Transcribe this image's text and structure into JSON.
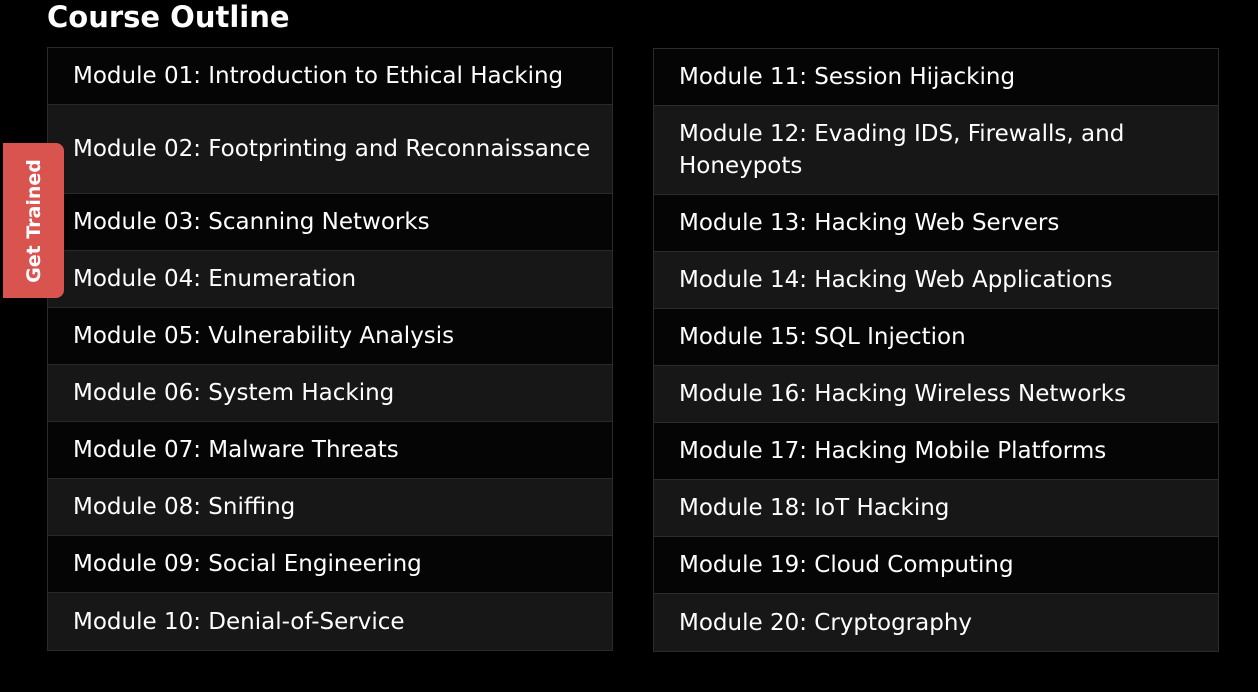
{
  "title": "Course Outline",
  "side_tab": {
    "label": "Get Trained",
    "color": "#d9534f"
  },
  "left_modules": [
    "Module 01: Introduction to Ethical Hacking",
    "Module 02: Footprinting and Reconnaissance",
    "Module 03: Scanning Networks",
    "Module 04: Enumeration",
    "Module 05: Vulnerability Analysis",
    "Module 06: System Hacking",
    "Module 07: Malware Threats",
    "Module 08: Sniffing",
    "Module 09: Social Engineering",
    "Module 10: Denial-of-Service"
  ],
  "right_modules": [
    "Module 11: Session Hijacking",
    "Module 12: Evading IDS, Firewalls, and Honeypots",
    "Module 13: Hacking Web Servers",
    "Module 14: Hacking Web Applications",
    "Module 15: SQL Injection",
    "Module 16: Hacking Wireless Networks",
    "Module 17: Hacking Mobile Platforms",
    "Module 18: IoT Hacking",
    "Module 19: Cloud Computing",
    "Module 20: Cryptography"
  ]
}
